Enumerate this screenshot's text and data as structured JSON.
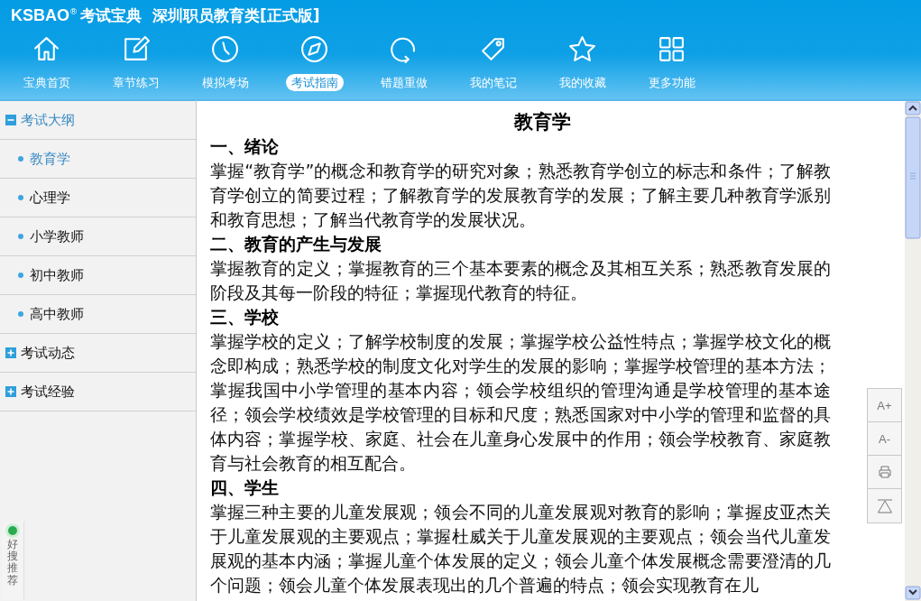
{
  "header": {
    "logo": "KSBAO",
    "logo_mark": "®",
    "brand": "考试宝典",
    "title": "深圳职员教育类[正式版]"
  },
  "nav": [
    {
      "label": "宝典首页",
      "kind": "home",
      "selected": false
    },
    {
      "label": "章节练习",
      "kind": "edit",
      "selected": false
    },
    {
      "label": "模拟考场",
      "kind": "clock",
      "selected": false
    },
    {
      "label": "考试指南",
      "kind": "compass",
      "selected": true
    },
    {
      "label": "错题重做",
      "kind": "redo",
      "selected": false
    },
    {
      "label": "我的笔记",
      "kind": "tag",
      "selected": false
    },
    {
      "label": "我的收藏",
      "kind": "star",
      "selected": false
    },
    {
      "label": "更多功能",
      "kind": "grid",
      "selected": false
    }
  ],
  "sidebar": {
    "items": [
      {
        "label": "考试大纲",
        "expanded": true,
        "children": [
          {
            "label": "教育学",
            "selected": true
          },
          {
            "label": "心理学",
            "selected": false
          },
          {
            "label": "小学教师",
            "selected": false
          },
          {
            "label": "初中教师",
            "selected": false
          },
          {
            "label": "高中教师",
            "selected": false
          }
        ]
      },
      {
        "label": "考试动态",
        "expanded": false
      },
      {
        "label": "考试经验",
        "expanded": false
      }
    ]
  },
  "article": {
    "title": "教育学",
    "sections": [
      {
        "heading": "一、绪论",
        "body": "掌握“教育学”的概念和教育学的研究对象；熟悉教育学创立的标志和条件；了解教育学创立的简要过程；了解教育学的发展教育学的发展；了解主要几种教育学派别和教育思想；了解当代教育学的发展状况。"
      },
      {
        "heading": "二、教育的产生与发展",
        "body": "掌握教育的定义；掌握教育的三个基本要素的概念及其相互关系；熟悉教育发展的阶段及其每一阶段的特征；掌握现代教育的特征。"
      },
      {
        "heading": "三、学校",
        "body": "掌握学校的定义；了解学校制度的发展；掌握学校公益性特点；掌握学校文化的概念即构成；熟悉学校的制度文化对学生的发展的影响；掌握学校管理的基本方法；掌握我国中小学管理的基本内容；领会学校组织的管理沟通是学校管理的基本途径；领会学校绩效是学校管理的目标和尺度；熟悉国家对中小学的管理和监督的具体内容；掌握学校、家庭、社会在儿童身心发展中的作用；领会学校教育、家庭教育与社会教育的相互配合。"
      },
      {
        "heading": "四、学生",
        "body": "掌握三种主要的儿童发展观；领会不同的儿童发展观对教育的影响；掌握皮亚杰关于儿童发展观的主要观点；掌握杜威关于儿童发展观的主要观点；领会当代儿童发展观的基本内涵；掌握儿童个体发展的定义；领会儿童个体发展概念需要澄清的几个问题；领会儿童个体发展表现出的几个普遍的特点；领会实现教育在儿"
      }
    ]
  },
  "tools": [
    {
      "kind": "text",
      "label": "A+"
    },
    {
      "kind": "text",
      "label": "A-"
    },
    {
      "kind": "print"
    },
    {
      "kind": "top"
    }
  ],
  "widget": {
    "label": "好搜推荐"
  }
}
